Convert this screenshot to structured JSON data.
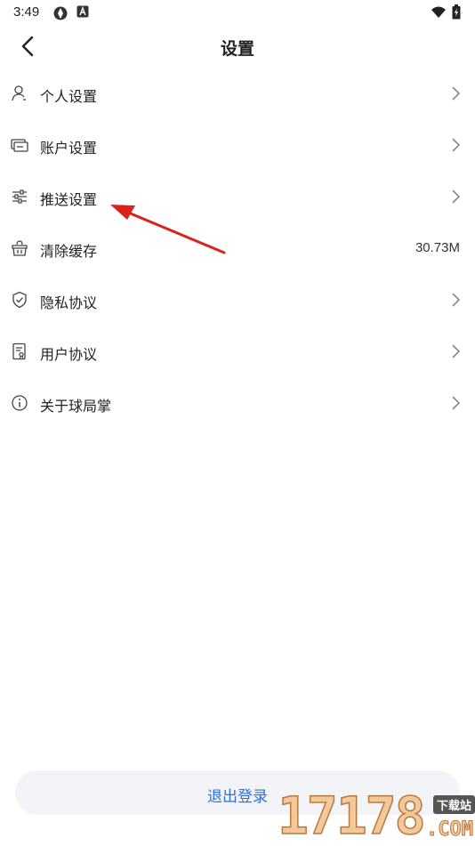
{
  "status_bar": {
    "time": "3:49",
    "icons": [
      "sync-icon",
      "a-badge-icon",
      "wifi-icon",
      "battery-icon"
    ]
  },
  "header": {
    "title": "设置",
    "back_icon": "chevron-left-icon"
  },
  "menu": {
    "items": [
      {
        "label": "个人设置",
        "icon": "person-icon",
        "trailing": "chevron"
      },
      {
        "label": "账户设置",
        "icon": "card-icon",
        "trailing": "chevron"
      },
      {
        "label": "推送设置",
        "icon": "sliders-icon",
        "trailing": "chevron"
      },
      {
        "label": "清除缓存",
        "icon": "basket-icon",
        "trailing": "value",
        "value": "30.73M"
      },
      {
        "label": "隐私协议",
        "icon": "shield-icon",
        "trailing": "chevron"
      },
      {
        "label": "用户协议",
        "icon": "document-icon",
        "trailing": "chevron"
      },
      {
        "label": "关于球局掌",
        "icon": "info-icon",
        "trailing": "chevron"
      }
    ]
  },
  "logout": {
    "label": "退出登录"
  },
  "colors": {
    "accent": "#2e6fe0",
    "annotation_arrow": "#d9221c",
    "button_bg": "#f2f4f7"
  },
  "watermark": {
    "digits": "17178",
    "badge": "下载站",
    "domain": ".COM"
  }
}
